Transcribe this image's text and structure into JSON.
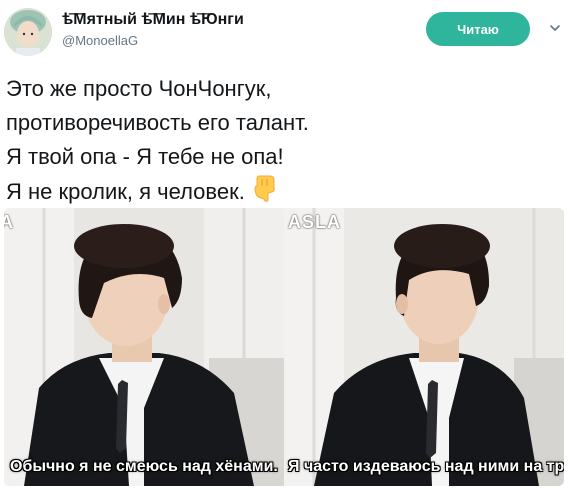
{
  "header": {
    "display_name": "ѣ͞Мятный ѣ͞Мин ѣ͞Юнги",
    "handle": "@MonoellaG",
    "follow_label": "Читаю",
    "avatar_icon": "user-avatar",
    "menu_icon": "chevron-down-icon"
  },
  "tweet": {
    "lines": [
      "Это же просто ЧонЧонгук,",
      "противоречивость его талант.",
      "Я твой опа - Я тебе не опа!",
      "Я не кролик, я человек."
    ],
    "emoji": "pointing-down-hand-icon"
  },
  "media": {
    "left": {
      "watermark": "A",
      "subtitle": "Обычно я не смеюсь над хёнами."
    },
    "right": {
      "watermark": "ASLA",
      "subtitle": "Я часто издеваюсь над ними на тр"
    }
  },
  "colors": {
    "follow_button": "#2fb59b",
    "handle_text": "#657786",
    "text": "#14171a"
  }
}
